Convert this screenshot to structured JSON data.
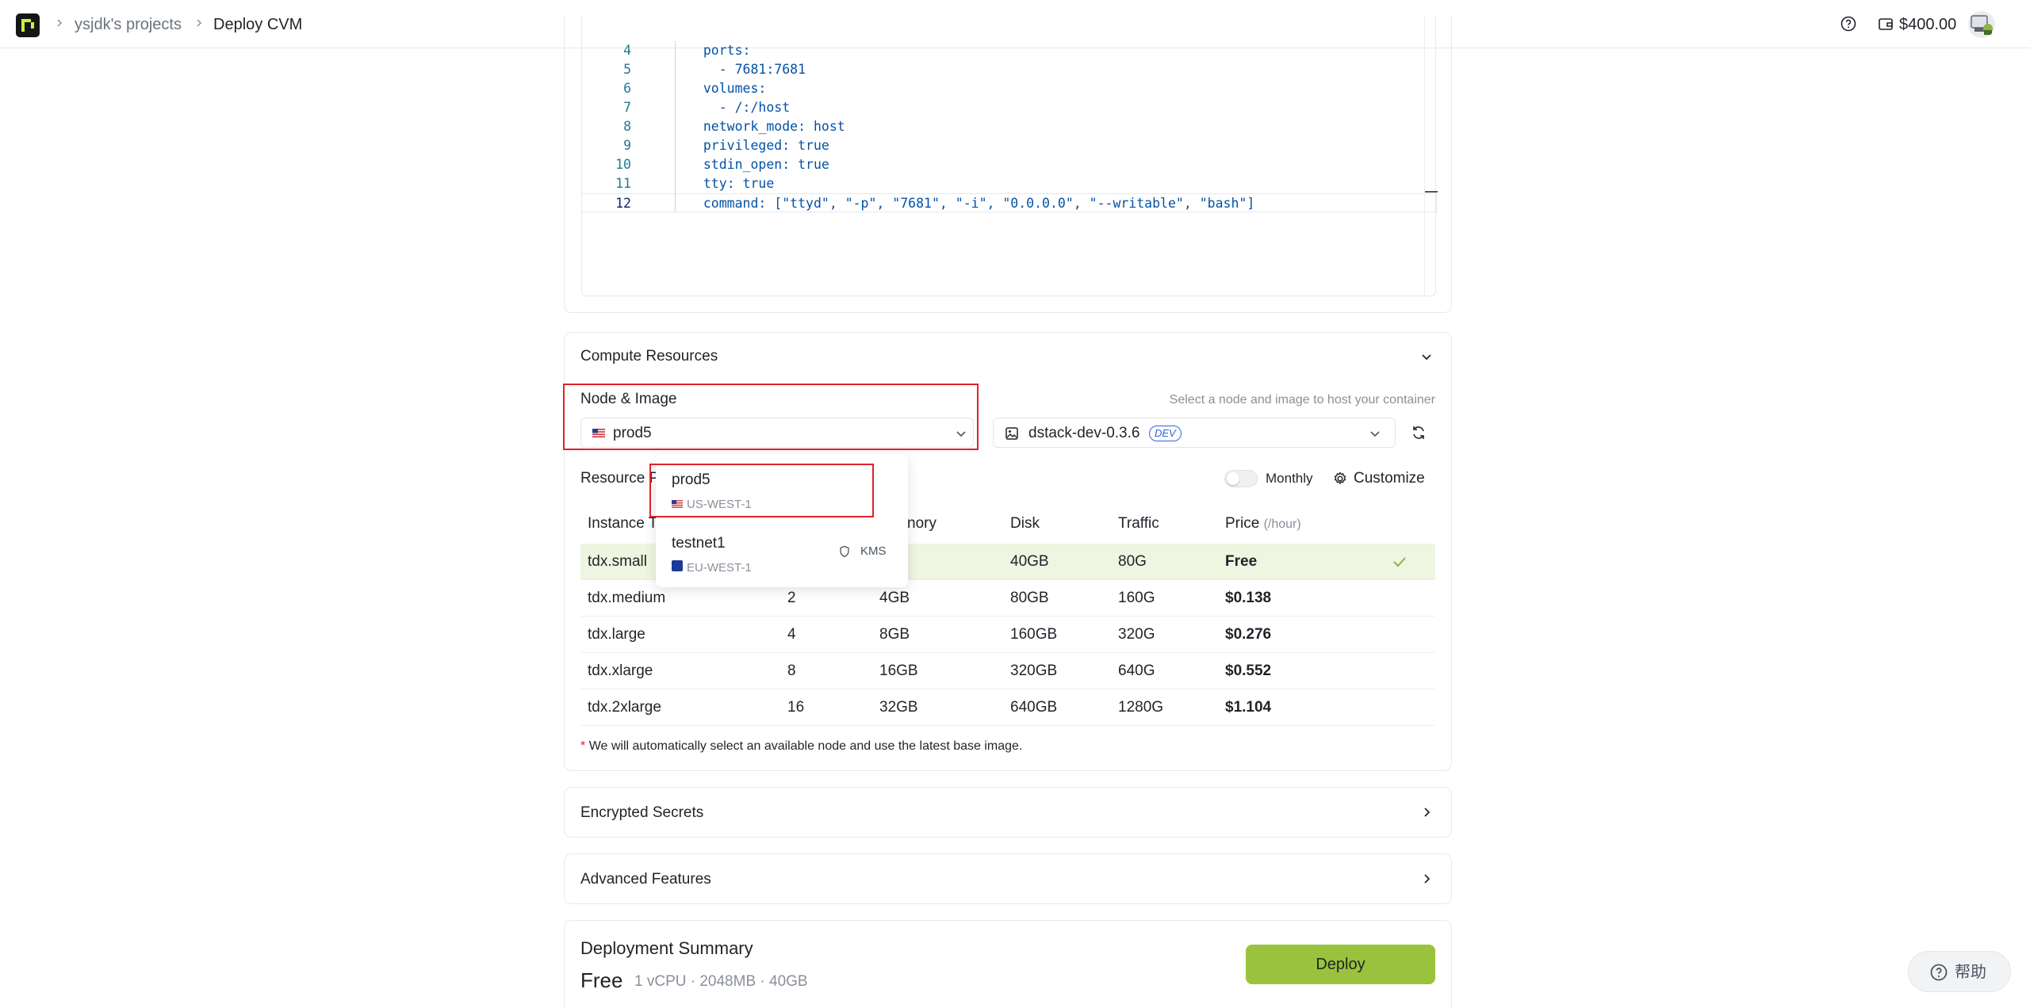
{
  "header": {
    "breadcrumb": [
      "ysjdk's projects",
      "Deploy CVM"
    ],
    "balance": "$400.00"
  },
  "editor": {
    "lines": [
      {
        "n": "4",
        "indent": "  ",
        "key": "ports",
        "rest": ":"
      },
      {
        "n": "5",
        "indent": "    ",
        "key": "",
        "rest": "- 7681:7681"
      },
      {
        "n": "6",
        "indent": "  ",
        "key": "volumes",
        "rest": ":"
      },
      {
        "n": "7",
        "indent": "    ",
        "key": "",
        "rest": "- /:/host"
      },
      {
        "n": "8",
        "indent": "  ",
        "key": "network_mode",
        "rest": ": host"
      },
      {
        "n": "9",
        "indent": "  ",
        "key": "privileged",
        "rest": ": true"
      },
      {
        "n": "10",
        "indent": "  ",
        "key": "stdin_open",
        "rest": ": true"
      },
      {
        "n": "11",
        "indent": "  ",
        "key": "tty",
        "rest": ": true"
      },
      {
        "n": "12",
        "indent": "  ",
        "key": "command",
        "rest": ": [\"ttyd\", \"-p\", \"7681\", \"-i\", \"0.0.0.0\", \"--writable\", \"bash\"]"
      }
    ]
  },
  "compute": {
    "title": "Compute Resources",
    "node_image_label": "Node & Image",
    "hint": "Select a node and image to host your container",
    "node_selected": "prod5",
    "image_selected": "dstack-dev-0.3.6",
    "image_badge": "DEV",
    "resource_label": "Resource P",
    "monthly_label": "Monthly",
    "customize_label": "Customize",
    "columns": {
      "instance": "Instance T",
      "memory": "nory",
      "disk": "Disk",
      "traffic": "Traffic",
      "price": "Price",
      "price_unit": "(/hour)"
    },
    "rows": [
      {
        "name": "tdx.small",
        "vcpu": "",
        "memory": "",
        "disk": "40GB",
        "traffic": "80G",
        "price": "Free",
        "selected": true
      },
      {
        "name": "tdx.medium",
        "vcpu": "2",
        "memory": "4GB",
        "disk": "80GB",
        "traffic": "160G",
        "price": "$0.138",
        "selected": false
      },
      {
        "name": "tdx.large",
        "vcpu": "4",
        "memory": "8GB",
        "disk": "160GB",
        "traffic": "320G",
        "price": "$0.276",
        "selected": false
      },
      {
        "name": "tdx.xlarge",
        "vcpu": "8",
        "memory": "16GB",
        "disk": "320GB",
        "traffic": "640G",
        "price": "$0.552",
        "selected": false
      },
      {
        "name": "tdx.2xlarge",
        "vcpu": "16",
        "memory": "32GB",
        "disk": "640GB",
        "traffic": "1280G",
        "price": "$1.104",
        "selected": false
      }
    ],
    "note_star": "*",
    "note": "We will automatically select an available node and use the latest base image."
  },
  "dropdown": {
    "options": [
      {
        "name": "prod5",
        "region": "US-WEST-1",
        "tag": ""
      },
      {
        "name": "testnet1",
        "region": "EU-WEST-1",
        "tag": "KMS"
      }
    ]
  },
  "sections": {
    "secrets": "Encrypted Secrets",
    "advanced": "Advanced Features"
  },
  "summary": {
    "title": "Deployment Summary",
    "price": "Free",
    "spec": "1 vCPU · 2048MB · 40GB",
    "deploy_label": "Deploy"
  },
  "help_float": {
    "label": "帮助"
  },
  "colors": {
    "accent": "#9bc23c",
    "highlight": "#e0222c",
    "selected_row": "#eef5e1",
    "badge": "#2c67d8"
  },
  "icons": [
    "phala-logo-icon",
    "chevron-right-icon",
    "help-circle-icon",
    "wallet-icon",
    "avatar",
    "chevron-down-icon",
    "us-flag-icon",
    "image-icon",
    "refresh-icon",
    "gear-icon",
    "check-icon",
    "shield-icon",
    "eu-flag-icon"
  ]
}
